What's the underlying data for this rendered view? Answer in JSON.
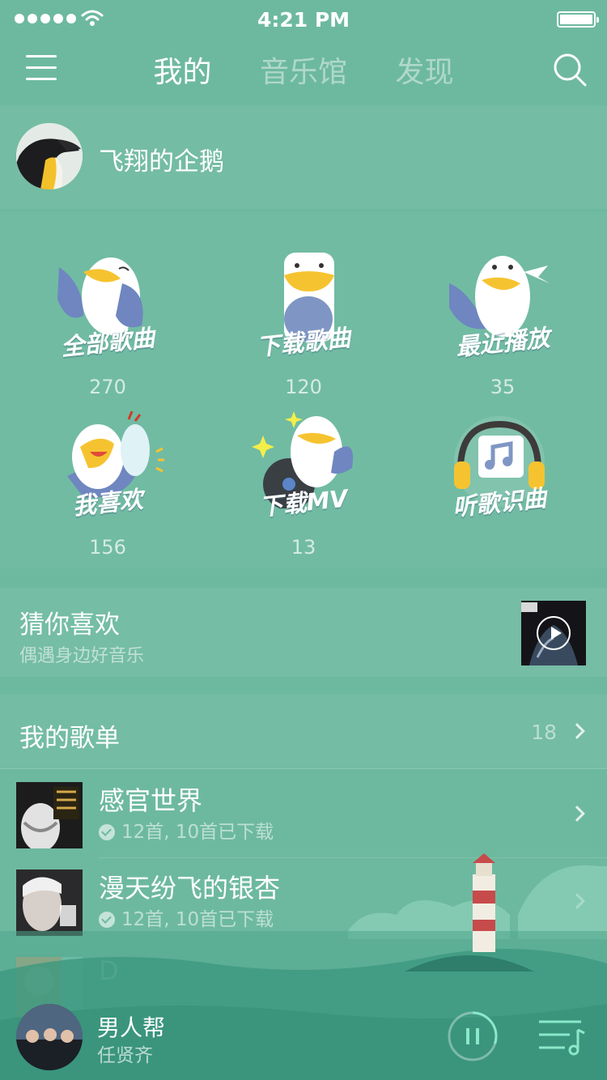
{
  "status_bar": {
    "time": "4:21 PM"
  },
  "nav": {
    "tabs": [
      {
        "label": "我的",
        "active": true
      },
      {
        "label": "音乐馆",
        "active": false
      },
      {
        "label": "发现",
        "active": false
      }
    ]
  },
  "profile": {
    "username": "飞翔的企鹅"
  },
  "grid": {
    "items": [
      {
        "label": "全部歌曲",
        "count": "270"
      },
      {
        "label": "下载歌曲",
        "count": "120"
      },
      {
        "label": "最近播放",
        "count": "35"
      },
      {
        "label": "我喜欢",
        "count": "156"
      },
      {
        "label": "下载MV",
        "count": "13"
      },
      {
        "label": "听歌识曲",
        "count": ""
      }
    ]
  },
  "recommend": {
    "title": "猜你喜欢",
    "subtitle": "偶遇身边好音乐"
  },
  "playlists": {
    "title": "我的歌单",
    "count": "18",
    "items": [
      {
        "name": "感官世界",
        "meta": "12首, 10首已下载"
      },
      {
        "name": "漫天纷飞的银杏",
        "meta": "12首, 10首已下载"
      },
      {
        "name": "D",
        "meta": ""
      }
    ]
  },
  "player": {
    "title": "男人帮",
    "artist": "任贤齐",
    "progress": 0.3
  },
  "colors": {
    "background": "#6db9a0",
    "scenery_dark": "#2f8f77",
    "accent": "#8be8c8"
  }
}
